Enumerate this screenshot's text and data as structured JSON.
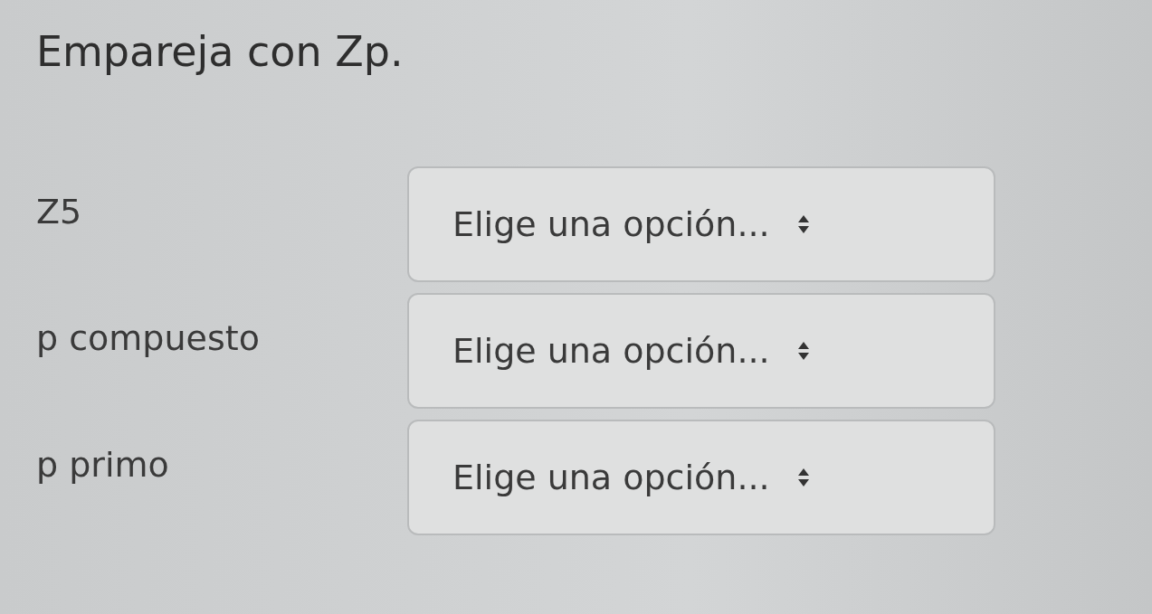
{
  "title": "Empareja con Zp.",
  "rows": [
    {
      "label": "Z5",
      "select": {
        "value": "Elige una opción..."
      }
    },
    {
      "label": "p compuesto",
      "select": {
        "value": "Elige una opción..."
      }
    },
    {
      "label": "p primo",
      "select": {
        "value": "Elige una opción..."
      }
    }
  ]
}
